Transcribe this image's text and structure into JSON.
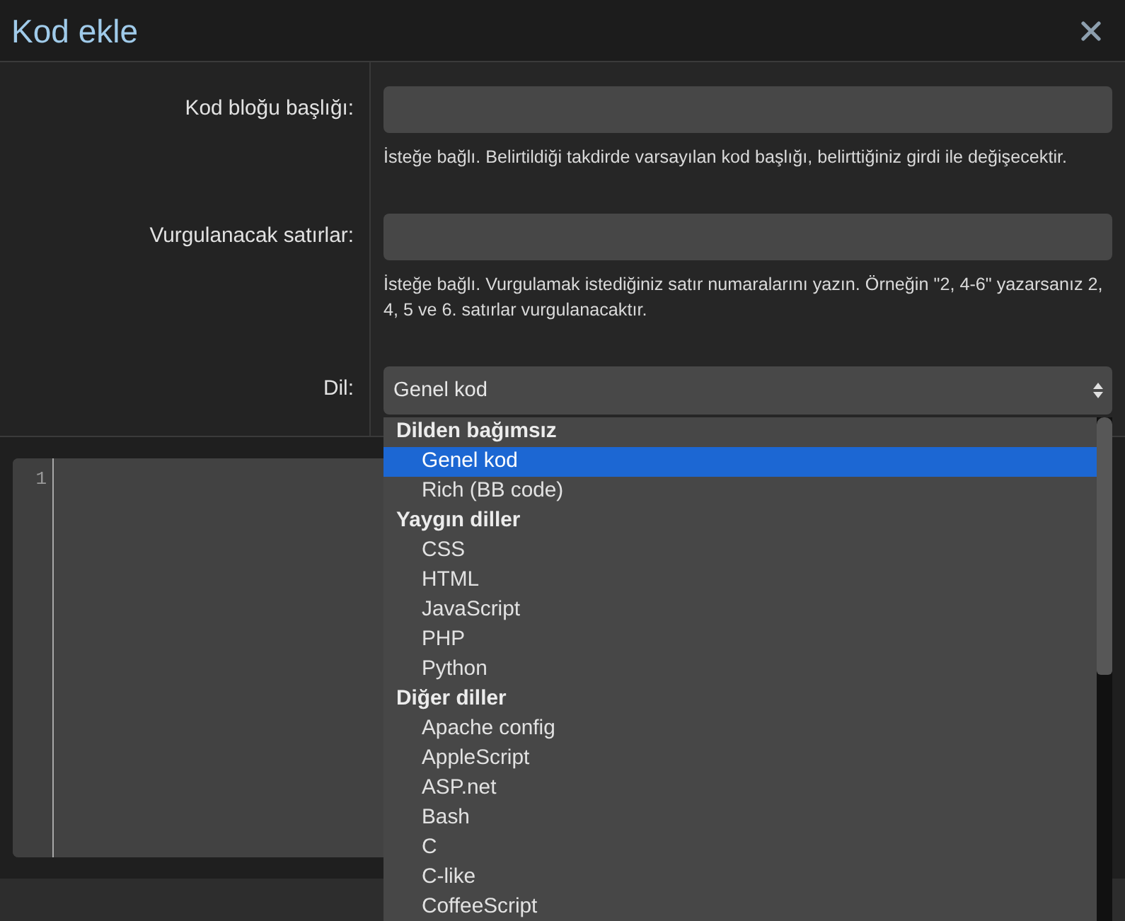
{
  "dialog": {
    "title": "Kod ekle"
  },
  "fields": [
    {
      "kind": "text",
      "label": "Kod bloğu başlığı:",
      "hint": "İsteğe bağlı. Belirtildiği takdirde varsayılan kod başlığı, belirttiğiniz girdi ile değişecektir."
    },
    {
      "kind": "text",
      "label": "Vurgulanacak satırlar:",
      "hint": "İsteğe bağlı. Vurgulamak istediğiniz satır numaralarını yazın. Örneğin \"2, 4-6\" yazarsanız 2, 4, 5 ve 6. satırlar vurgulanacaktır."
    },
    {
      "kind": "select",
      "label": "Dil:",
      "value": "Genel kod",
      "expanded": true,
      "groups": [
        {
          "label": "Dilden bağımsız",
          "options": [
            {
              "label": "Genel kod",
              "selected": true
            },
            {
              "label": "Rich (BB code)",
              "selected": false
            }
          ]
        },
        {
          "label": "Yaygın diller",
          "options": [
            {
              "label": "CSS",
              "selected": false
            },
            {
              "label": "HTML",
              "selected": false
            },
            {
              "label": "JavaScript",
              "selected": false
            },
            {
              "label": "PHP",
              "selected": false
            },
            {
              "label": "Python",
              "selected": false
            }
          ]
        },
        {
          "label": "Diğer diller",
          "options": [
            {
              "label": "Apache config",
              "selected": false
            },
            {
              "label": "AppleScript",
              "selected": false
            },
            {
              "label": "ASP.net",
              "selected": false
            },
            {
              "label": "Bash",
              "selected": false
            },
            {
              "label": "C",
              "selected": false
            },
            {
              "label": "C-like",
              "selected": false
            },
            {
              "label": "CoffeeScript",
              "selected": false
            }
          ]
        }
      ]
    }
  ],
  "editor": {
    "line_numbers": [
      "1"
    ]
  }
}
